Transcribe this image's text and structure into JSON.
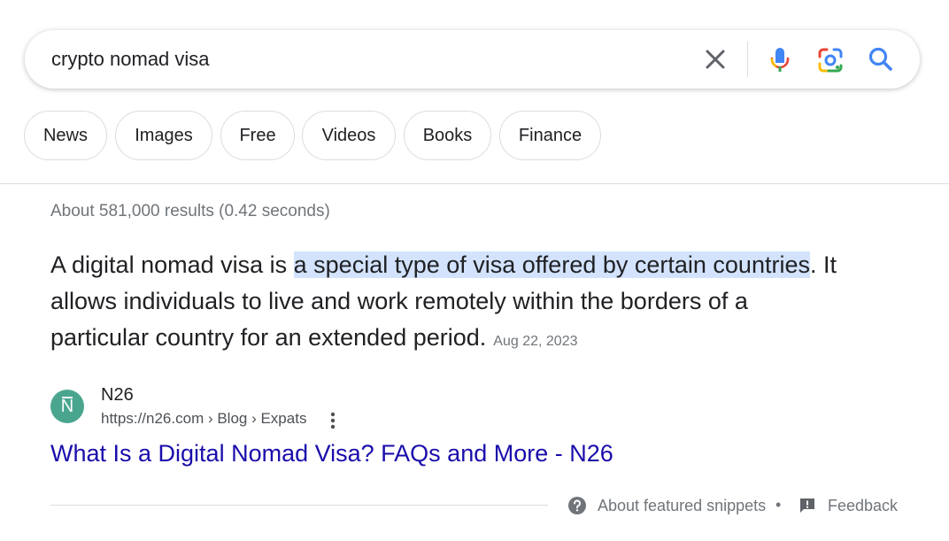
{
  "search": {
    "query": "crypto nomad visa"
  },
  "chips": [
    {
      "label": "News"
    },
    {
      "label": "Images"
    },
    {
      "label": "Free"
    },
    {
      "label": "Videos"
    },
    {
      "label": "Books"
    },
    {
      "label": "Finance"
    }
  ],
  "results_stats": "About 581,000 results (0.42 seconds)",
  "snippet": {
    "text_before": "A digital nomad visa is ",
    "highlight": "a special type of visa offered by certain countries",
    "text_after": ". It allows individuals to live and work remotely within the borders of a particular country for an extended period.",
    "date": "Aug 22, 2023"
  },
  "source": {
    "logo_letter": "N",
    "name": "N26",
    "url": "https://n26.com › Blog › Expats",
    "title": "What Is a Digital Nomad Visa? FAQs and More - N26"
  },
  "footer": {
    "about_label": "About featured snippets",
    "separator": "•",
    "feedback_label": "Feedback"
  },
  "colors": {
    "link": "#1a0dab",
    "highlight": "#d3e3fd",
    "logo_bg": "#4aa58f"
  },
  "icons": [
    "close-icon",
    "microphone-icon",
    "google-lens-icon",
    "search-icon",
    "more-vert-icon",
    "help-icon",
    "feedback-icon"
  ]
}
